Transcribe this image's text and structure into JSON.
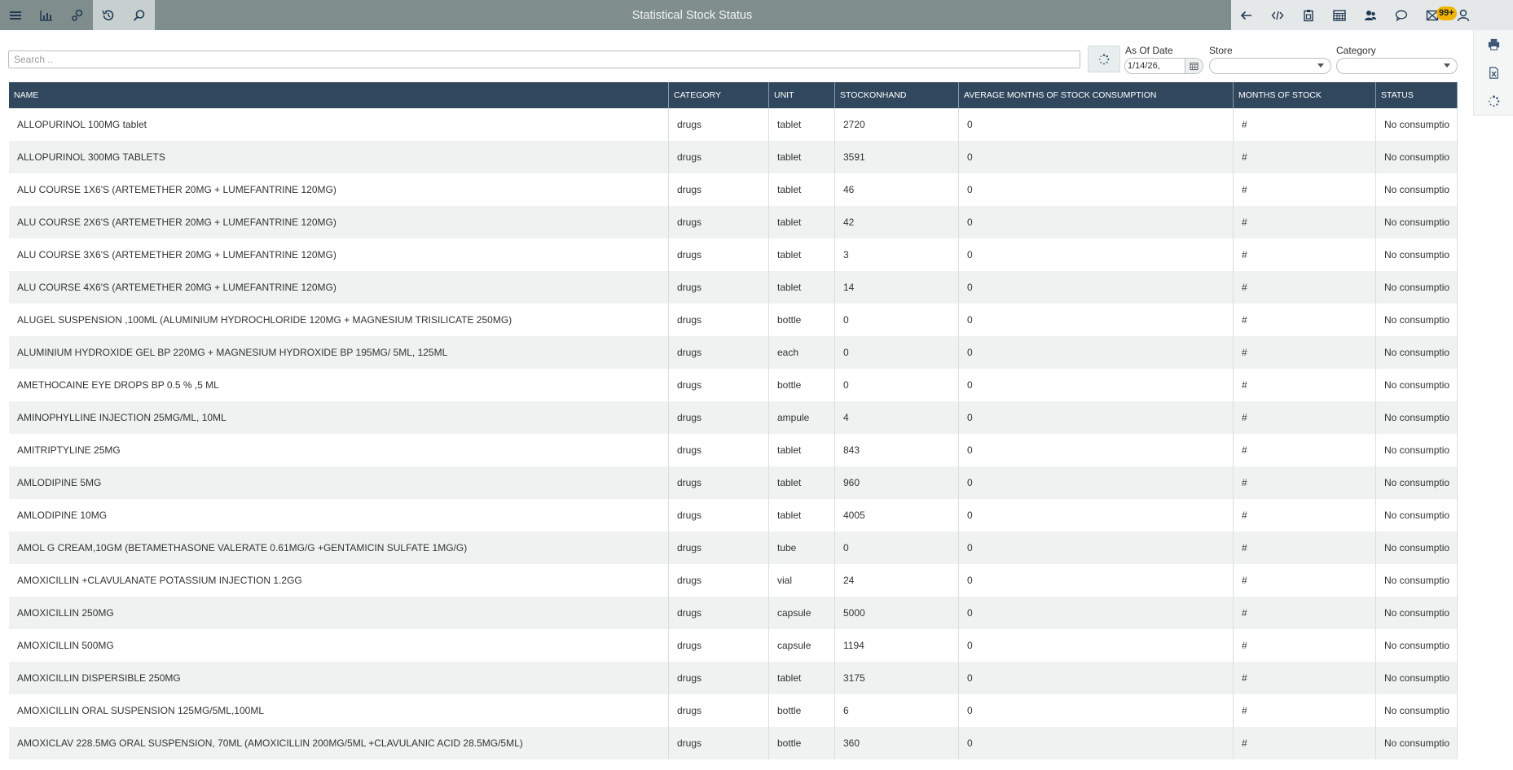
{
  "window": {
    "title": "Statistical Stock Status"
  },
  "toolbar_left": [
    {
      "name": "menu-icon"
    },
    {
      "name": "chart-icon"
    },
    {
      "name": "settings-icon"
    },
    {
      "name": "history-icon"
    },
    {
      "name": "search-icon"
    }
  ],
  "toolbar_right": [
    {
      "name": "back-arrow-icon"
    },
    {
      "name": "code-icon"
    },
    {
      "name": "clipboard-icon"
    },
    {
      "name": "calculator-icon"
    },
    {
      "name": "users-icon"
    },
    {
      "name": "chat-icon"
    },
    {
      "name": "mail-icon"
    },
    {
      "name": "user-icon"
    }
  ],
  "notifications": {
    "badge": "99+"
  },
  "side_tools": [
    {
      "name": "print-icon"
    },
    {
      "name": "excel-icon"
    },
    {
      "name": "loading-icon"
    }
  ],
  "filters": {
    "search_placeholder": "Search ..",
    "as_of_date_label": "As Of Date",
    "as_of_date_value": "1/14/26,",
    "store_label": "Store",
    "store_value": "",
    "category_label": "Category",
    "category_value": ""
  },
  "table": {
    "headers": [
      "NAME",
      "CATEGORY",
      "UNIT",
      "STOCKONHAND",
      "AVERAGE MONTHS OF STOCK CONSUMPTION",
      "MONTHS OF STOCK",
      "STATUS"
    ],
    "rows": [
      [
        "ALLOPURINOL 100MG tablet",
        "drugs",
        "tablet",
        "2720",
        "0",
        "#",
        "No consumptio"
      ],
      [
        "ALLOPURINOL 300MG TABLETS",
        "drugs",
        "tablet",
        "3591",
        "0",
        "#",
        "No consumptio"
      ],
      [
        "ALU COURSE 1X6'S (ARTEMETHER 20MG + LUMEFANTRINE 120MG)",
        "drugs",
        "tablet",
        "46",
        "0",
        "#",
        "No consumptio"
      ],
      [
        "ALU COURSE 2X6'S (ARTEMETHER 20MG + LUMEFANTRINE 120MG)",
        "drugs",
        "tablet",
        "42",
        "0",
        "#",
        "No consumptio"
      ],
      [
        "ALU COURSE 3X6'S (ARTEMETHER 20MG + LUMEFANTRINE 120MG)",
        "drugs",
        "tablet",
        "3",
        "0",
        "#",
        "No consumptio"
      ],
      [
        "ALU COURSE 4X6'S (ARTEMETHER 20MG + LUMEFANTRINE 120MG)",
        "drugs",
        "tablet",
        "14",
        "0",
        "#",
        "No consumptio"
      ],
      [
        "ALUGEL SUSPENSION ,100ML (ALUMINIUM HYDROCHLORIDE 120MG + MAGNESIUM TRISILICATE 250MG)",
        "drugs",
        "bottle",
        "0",
        "0",
        "#",
        "No consumptio"
      ],
      [
        "ALUMINIUM HYDROXIDE GEL BP 220MG + MAGNESIUM HYDROXIDE BP 195MG/ 5ML, 125ML",
        "drugs",
        "each",
        "0",
        "0",
        "#",
        "No consumptio"
      ],
      [
        "AMETHOCAINE EYE DROPS BP 0.5 % ,5 ML",
        "drugs",
        "bottle",
        "0",
        "0",
        "#",
        "No consumptio"
      ],
      [
        "AMINOPHYLLINE INJECTION 25MG/ML, 10ML",
        "drugs",
        "ampule",
        "4",
        "0",
        "#",
        "No consumptio"
      ],
      [
        "AMITRIPTYLINE 25MG",
        "drugs",
        "tablet",
        "843",
        "0",
        "#",
        "No consumptio"
      ],
      [
        "AMLODIPINE 5MG",
        "drugs",
        "tablet",
        "960",
        "0",
        "#",
        "No consumptio"
      ],
      [
        "AMLODIPINE 10MG",
        "drugs",
        "tablet",
        "4005",
        "0",
        "#",
        "No consumptio"
      ],
      [
        "AMOL G CREAM,10GM (BETAMETHASONE VALERATE 0.61MG/G +GENTAMICIN SULFATE 1MG/G)",
        "drugs",
        "tube",
        "0",
        "0",
        "#",
        "No consumptio"
      ],
      [
        "AMOXICILLIN +CLAVULANATE POTASSIUM INJECTION 1.2GG",
        "drugs",
        "vial",
        "24",
        "0",
        "#",
        "No consumptio"
      ],
      [
        "AMOXICILLIN 250MG",
        "drugs",
        "capsule",
        "5000",
        "0",
        "#",
        "No consumptio"
      ],
      [
        "AMOXICILLIN 500MG",
        "drugs",
        "capsule",
        "1194",
        "0",
        "#",
        "No consumptio"
      ],
      [
        "AMOXICILLIN DISPERSIBLE 250MG",
        "drugs",
        "tablet",
        "3175",
        "0",
        "#",
        "No consumptio"
      ],
      [
        "AMOXICILLIN ORAL SUSPENSION 125MG/5ML,100ML",
        "drugs",
        "bottle",
        "6",
        "0",
        "#",
        "No consumptio"
      ],
      [
        "AMOXICLAV 228.5MG ORAL SUSPENSION, 70ML (AMOXICILLIN 200MG/5ML +CLAVULANIC ACID 28.5MG/5ML)",
        "drugs",
        "bottle",
        "360",
        "0",
        "#",
        "No consumptio"
      ]
    ]
  }
}
